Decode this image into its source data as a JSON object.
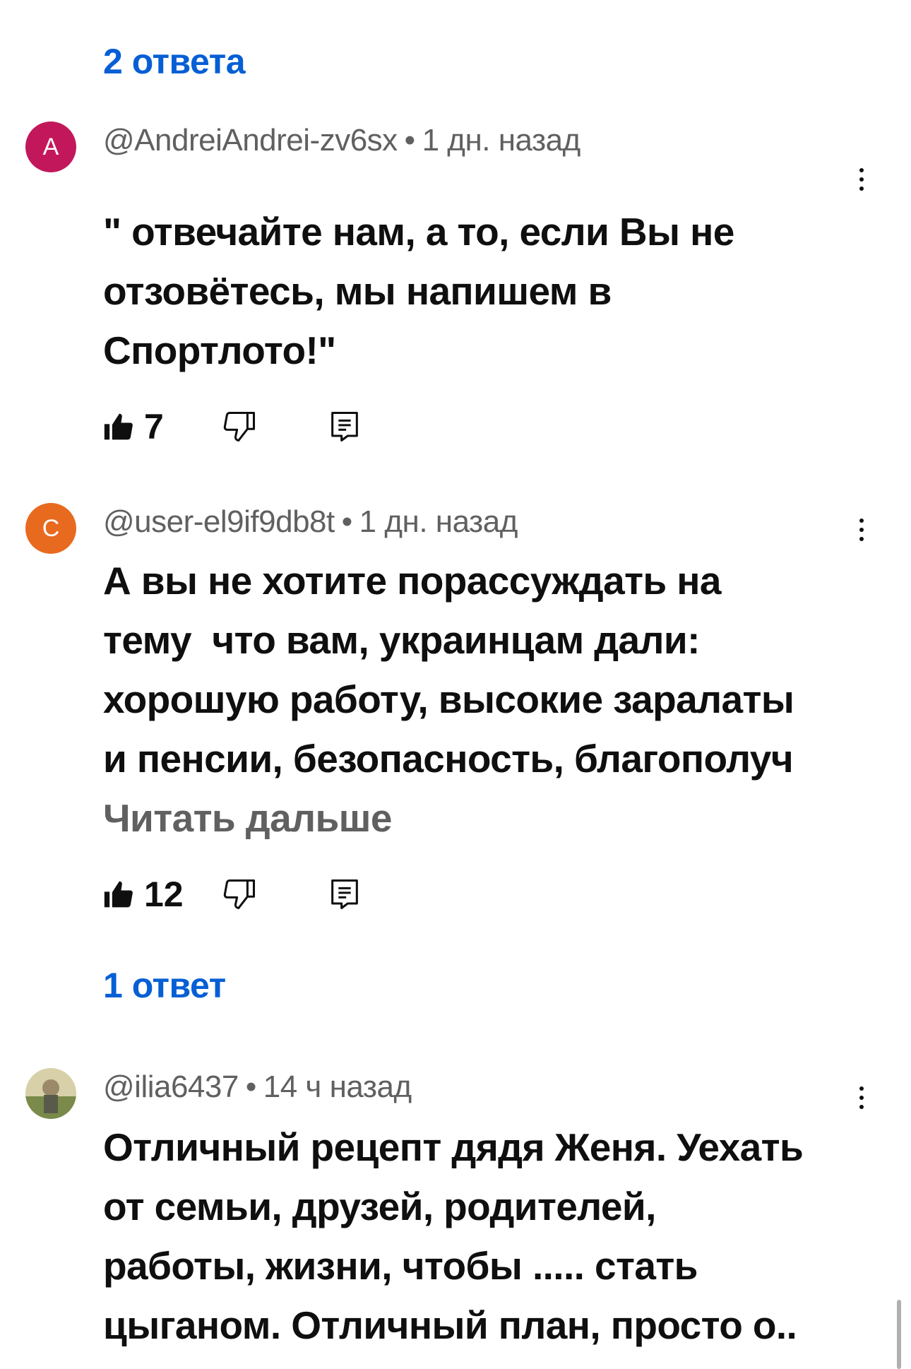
{
  "thread_top": {
    "replies_label": "2 ответа"
  },
  "comments": [
    {
      "avatar_letter": "A",
      "avatar_color": "#c2185b",
      "author": "@AndreiAndrei-zv6sx",
      "separator": "•",
      "time": "1 дн. назад",
      "text": "\" отвечайте нам, а то, если Вы не\nотзовётесь, мы напишем в\nСпортлото!\"",
      "likes": "7"
    },
    {
      "avatar_letter": "C",
      "avatar_color": "#e86a1f",
      "author": "@user-el9if9db8t",
      "separator": "•",
      "time": "1 дн. назад",
      "text": "А вы не хотите порассуждать на\nтему  что вам, украинцам дали:\nхорошую работу, высокие заралаты\nи пенсии, безопасность, благополуч",
      "read_more": "Читать дальше",
      "likes": "12",
      "replies_label": "1 ответ"
    },
    {
      "avatar_letter": "",
      "avatar_color": "#8a9a5b",
      "author": "@ilia6437",
      "separator": "•",
      "time": "14 ч назад",
      "text": "Отличный рецепт дядя Женя. Уехать\nот семьи, друзей, родителей,\nработы, жизни, чтобы ..... стать\nцыганом. Отличный план, просто о.."
    }
  ],
  "icons": {
    "like": "thumbs-up-icon",
    "dislike": "thumbs-down-icon",
    "reply": "reply-icon",
    "menu": "more-vert-icon"
  }
}
